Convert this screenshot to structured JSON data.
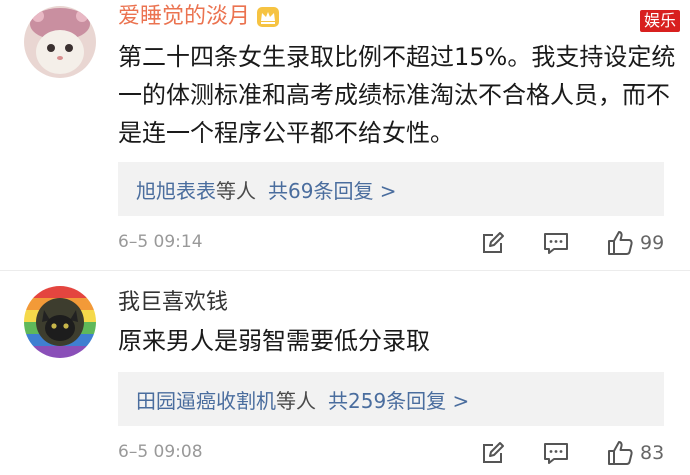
{
  "watermark": {
    "ghost_text": "",
    "badge": "娱乐"
  },
  "comments": [
    {
      "username": "爱睡觉的淡月",
      "vip_badge_icon": "crown-icon",
      "text": "第二十四条女生录取比例不超过15%。我支持设定统一的体测标准和高考成绩标准淘汰不合格人员，而不是连一个程序公平都不给女性。",
      "reply_names": "旭旭表表",
      "reply_deng": "等人",
      "reply_count": "共69条回复 >",
      "timestamp": "6–5 09:14",
      "likes": "99",
      "icons": [
        "share-icon",
        "comment-icon",
        "like-icon"
      ]
    },
    {
      "username": "我巨喜欢钱",
      "text": "原来男人是弱智需要低分录取",
      "reply_names": "田园逼癌收割机",
      "reply_deng": "等人",
      "reply_count": "共259条回复 >",
      "timestamp": "6–5 09:08",
      "likes": "83",
      "icons": [
        "share-icon",
        "comment-icon",
        "like-icon"
      ]
    }
  ],
  "colors": {
    "username_vip": "#eb7350",
    "link_blue": "#4a6d9e",
    "reply_bg": "#f2f2f2",
    "badge_red": "#d8201f"
  }
}
